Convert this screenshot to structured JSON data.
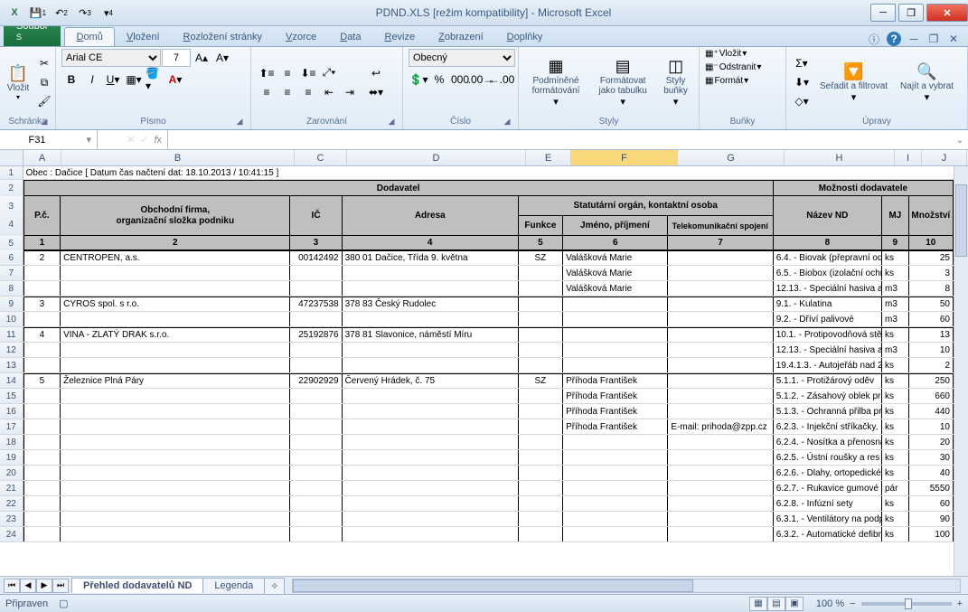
{
  "title": "PDND.XLS  [režim kompatibility]  -  Microsoft Excel",
  "qat_badges": [
    "1",
    "2",
    "3",
    "4"
  ],
  "ribbon": {
    "file": "Soubor",
    "file_key": "S",
    "tabs": [
      "Domů",
      "Vložení",
      "Rozložení stránky",
      "Vzorce",
      "Data",
      "Revize",
      "Zobrazení",
      "Doplňky"
    ],
    "tabs_keys": [
      "ů",
      "V",
      "P",
      "C",
      "A",
      "R",
      "W",
      "Y"
    ],
    "groups": {
      "clipboard": {
        "label": "Schránka",
        "paste": "Vložit"
      },
      "font": {
        "label": "Písmo",
        "name": "Arial CE",
        "size": "7"
      },
      "align": {
        "label": "Zarovnání"
      },
      "number": {
        "label": "Číslo",
        "format": "Obecný"
      },
      "styles": {
        "label": "Styly",
        "cond": "Podmíněné formátování",
        "table": "Formátovat jako tabulku",
        "cell": "Styly buňky"
      },
      "cells": {
        "label": "Buňky",
        "insert": "Vložit",
        "delete": "Odstranit",
        "format": "Formát"
      },
      "editing": {
        "label": "Úpravy",
        "sort": "Seřadit a filtrovat",
        "find": "Najít a vybrat"
      }
    }
  },
  "namebox": "F31",
  "columns": [
    "A",
    "B",
    "C",
    "D",
    "E",
    "F",
    "G",
    "H",
    "I",
    "J"
  ],
  "meta_row": "Obec : Dačice [ Datum čas načtení dat: 18.10.2013 / 10:41:15 ]",
  "hdr": {
    "dodavatel": "Dodavatel",
    "moznosti": "Možnosti dodavatele",
    "pc": "P.č.",
    "firma": "Obchodní firma,\norganizační složka podniku",
    "ic": "IČ",
    "adresa": "Adresa",
    "statut": "Statutární orgán, kontaktní osoba",
    "funkce": "Funkce",
    "jmeno": "Jméno, příjmení",
    "tel": "Telekomunikační spojení",
    "nazev": "Název ND",
    "mj": "MJ",
    "mn": "Množství",
    "nums": [
      "1",
      "2",
      "3",
      "4",
      "5",
      "6",
      "7",
      "8",
      "9",
      "10"
    ]
  },
  "rows": [
    {
      "r": "6",
      "pc": "2",
      "firma": "CENTROPEN,  a.s.",
      "ic": "00142492",
      "adr": "380 01 Dačice, Třída 9. května",
      "fn": "SZ",
      "jm": "Valášková Marie",
      "tel": "",
      "nd": "6.4. - Biovak (přepravní od",
      "mj": "ks",
      "mn": "25",
      "tb": true
    },
    {
      "r": "7",
      "pc": "",
      "firma": "",
      "ic": "",
      "adr": "",
      "fn": "",
      "jm": "Valášková Marie",
      "tel": "",
      "nd": "6.5. - Biobox (izolační ochr",
      "mj": "ks",
      "mn": "3"
    },
    {
      "r": "8",
      "pc": "",
      "firma": "",
      "ic": "",
      "adr": "",
      "fn": "",
      "jm": "Valášková Marie",
      "tel": "",
      "nd": "12.13. - Speciální hasiva a",
      "mj": "m3",
      "mn": "8"
    },
    {
      "r": "9",
      "pc": "3",
      "firma": "CYROS spol. s r.o.",
      "ic": "47237538",
      "adr": "378 83 Český Rudolec",
      "fn": "",
      "jm": "",
      "tel": "",
      "nd": "9.1. - Kulatina",
      "mj": "m3",
      "mn": "50",
      "tb": true
    },
    {
      "r": "10",
      "pc": "",
      "firma": "",
      "ic": "",
      "adr": "",
      "fn": "",
      "jm": "",
      "tel": "",
      "nd": "9.2. - Dříví palivové",
      "mj": "m3",
      "mn": "60"
    },
    {
      "r": "11",
      "pc": "4",
      "firma": "VINA - ZLATÝ DRAK s.r.o.",
      "ic": "25192876",
      "adr": "378 81 Slavonice, náměstí Míru",
      "fn": "",
      "jm": "",
      "tel": "",
      "nd": "10.1. - Protipovodňová stě",
      "mj": "ks",
      "mn": "13",
      "tb": true
    },
    {
      "r": "12",
      "pc": "",
      "firma": "",
      "ic": "",
      "adr": "",
      "fn": "",
      "jm": "",
      "tel": "",
      "nd": "12.13. - Speciální hasiva a",
      "mj": "m3",
      "mn": "10"
    },
    {
      "r": "13",
      "pc": "",
      "firma": "",
      "ic": "",
      "adr": "",
      "fn": "",
      "jm": "",
      "tel": "",
      "nd": "19.4.1.3. - Autojeřáb nad 2",
      "mj": "ks",
      "mn": "2"
    },
    {
      "r": "14",
      "pc": "5",
      "firma": "Železnice Plná Páry",
      "ic": "22902929",
      "adr": "Červený Hrádek, č. 75",
      "fn": "SZ",
      "jm": "Příhoda František",
      "tel": "",
      "nd": "5.1.1. - Protižárový oděv",
      "mj": "ks",
      "mn": "250",
      "tb": true
    },
    {
      "r": "15",
      "pc": "",
      "firma": "",
      "ic": "",
      "adr": "",
      "fn": "",
      "jm": "Příhoda František",
      "tel": "",
      "nd": "5.1.2. - Zásahový oblek pr",
      "mj": "ks",
      "mn": "660"
    },
    {
      "r": "16",
      "pc": "",
      "firma": "",
      "ic": "",
      "adr": "",
      "fn": "",
      "jm": "Příhoda František",
      "tel": "",
      "nd": "5.1.3. - Ochranná přilba pra",
      "mj": "ks",
      "mn": "440"
    },
    {
      "r": "17",
      "pc": "",
      "firma": "",
      "ic": "",
      "adr": "",
      "fn": "",
      "jm": "Příhoda František",
      "tel": "E-mail: prihoda@zpp.cz",
      "nd": "6.2.3. - Injekční stříkačky,",
      "mj": "ks",
      "mn": "10"
    },
    {
      "r": "18",
      "pc": "",
      "firma": "",
      "ic": "",
      "adr": "",
      "fn": "",
      "jm": "",
      "tel": "",
      "nd": "6.2.4. - Nosítka a přenosná",
      "mj": "ks",
      "mn": "20"
    },
    {
      "r": "19",
      "pc": "",
      "firma": "",
      "ic": "",
      "adr": "",
      "fn": "",
      "jm": "",
      "tel": "",
      "nd": "6.2.5. - Ústní roušky a res",
      "mj": "ks",
      "mn": "30"
    },
    {
      "r": "20",
      "pc": "",
      "firma": "",
      "ic": "",
      "adr": "",
      "fn": "",
      "jm": "",
      "tel": "",
      "nd": "6.2.6. - Dlahy, ortopedické",
      "mj": "ks",
      "mn": "40"
    },
    {
      "r": "21",
      "pc": "",
      "firma": "",
      "ic": "",
      "adr": "",
      "fn": "",
      "jm": "",
      "tel": "",
      "nd": "6.2.7. - Rukavice gumové",
      "mj": "pár",
      "mn": "5550"
    },
    {
      "r": "22",
      "pc": "",
      "firma": "",
      "ic": "",
      "adr": "",
      "fn": "",
      "jm": "",
      "tel": "",
      "nd": "6.2.8. - Infúzní sety",
      "mj": "ks",
      "mn": "60"
    },
    {
      "r": "23",
      "pc": "",
      "firma": "",
      "ic": "",
      "adr": "",
      "fn": "",
      "jm": "",
      "tel": "",
      "nd": "6.3.1. - Ventilátory na podp",
      "mj": "ks",
      "mn": "90"
    },
    {
      "r": "24",
      "pc": "",
      "firma": "",
      "ic": "",
      "adr": "",
      "fn": "",
      "jm": "",
      "tel": "",
      "nd": "6.3.2. - Automatické defibri",
      "mj": "ks",
      "mn": "100"
    }
  ],
  "sheets": {
    "active": "Přehled dodavatelů ND",
    "other": "Legenda"
  },
  "status": {
    "ready": "Připraven",
    "zoom": "100 %"
  }
}
